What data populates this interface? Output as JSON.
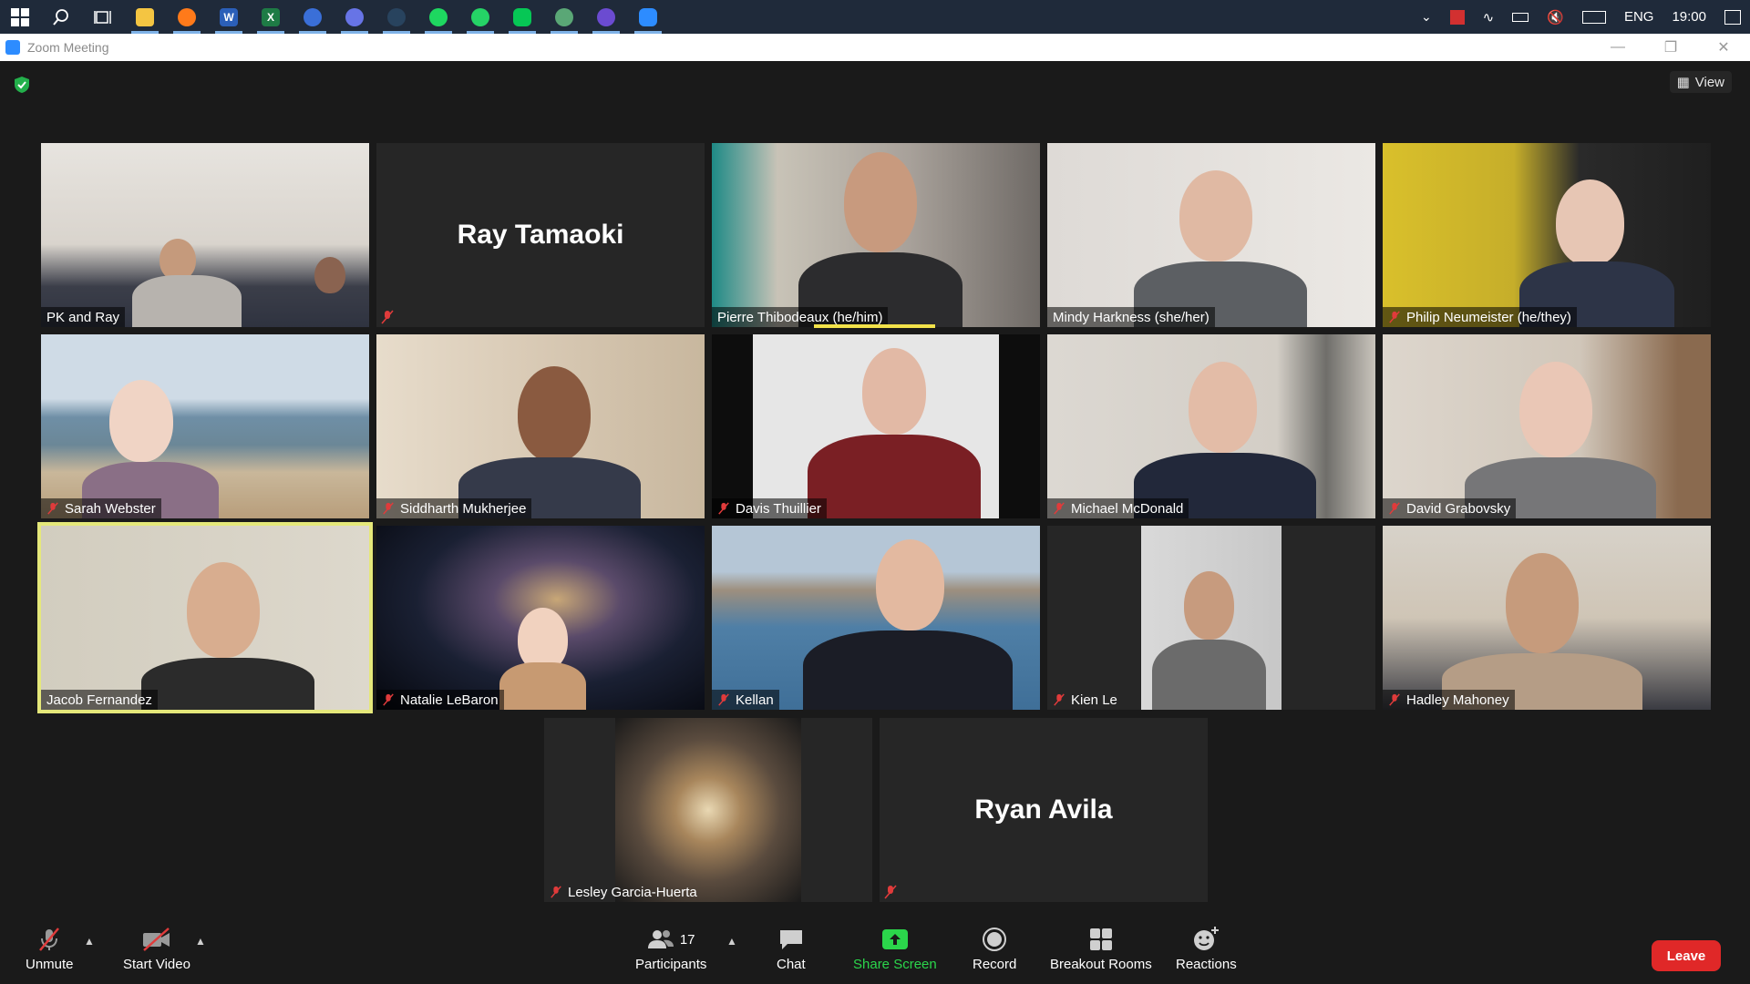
{
  "taskbar": {
    "language": "ENG",
    "time": "19:00",
    "apps": [
      "search-icon",
      "task-view-icon",
      "file-explorer-icon",
      "firefox-icon",
      "word-icon",
      "excel-icon",
      "onepassword-icon",
      "discord-icon",
      "steam-icon",
      "spotify-icon",
      "whatsapp-icon",
      "line-icon",
      "chatgpt-icon",
      "github-icon",
      "zoom-icon"
    ]
  },
  "window": {
    "title": "Zoom Meeting"
  },
  "meeting": {
    "view_label": "View",
    "talking_indicator_color": "#f2e24a",
    "speaker_highlight_color": "#e5e87a",
    "participants": [
      {
        "name": "PK and Ray",
        "muted": false,
        "video": true
      },
      {
        "name": "Ray Tamaoki",
        "muted": true,
        "video": false
      },
      {
        "name": "Pierre Thibodeaux (he/him)",
        "muted": false,
        "video": true
      },
      {
        "name": "Mindy Harkness (she/her)",
        "muted": false,
        "video": true
      },
      {
        "name": "Philip Neumeister (he/they)",
        "muted": true,
        "video": true
      },
      {
        "name": "Sarah Webster",
        "muted": true,
        "video": true
      },
      {
        "name": "Siddharth Mukherjee",
        "muted": true,
        "video": true
      },
      {
        "name": "Davis Thuillier",
        "muted": true,
        "video": true
      },
      {
        "name": "Michael McDonald",
        "muted": true,
        "video": true
      },
      {
        "name": "David Grabovsky",
        "muted": true,
        "video": true
      },
      {
        "name": "Jacob Fernandez",
        "muted": false,
        "video": true
      },
      {
        "name": "Natalie LeBaron",
        "muted": true,
        "video": true
      },
      {
        "name": "Kellan",
        "muted": true,
        "video": true
      },
      {
        "name": "Kien Le",
        "muted": true,
        "video": true
      },
      {
        "name": "Hadley Mahoney",
        "muted": true,
        "video": true
      },
      {
        "name": "Lesley Garcia-Huerta",
        "muted": true,
        "video": true
      },
      {
        "name": "Ryan Avila",
        "muted": true,
        "video": false
      }
    ]
  },
  "controls": {
    "unmute": "Unmute",
    "start_video": "Start Video",
    "participants": "Participants",
    "participant_count": "17",
    "chat": "Chat",
    "share_screen": "Share Screen",
    "record": "Record",
    "breakout_rooms": "Breakout Rooms",
    "reactions": "Reactions",
    "leave": "Leave",
    "share_color": "#2bd64b",
    "leave_color": "#e02828"
  }
}
